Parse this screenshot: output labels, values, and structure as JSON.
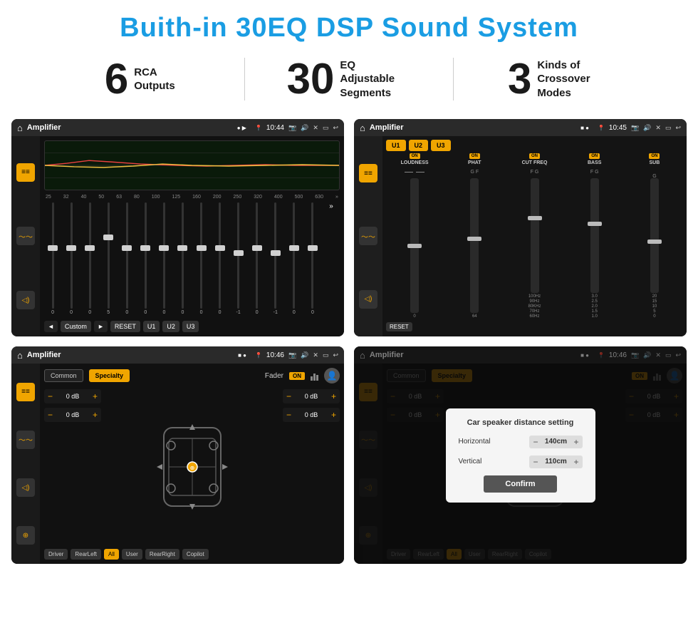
{
  "page": {
    "title": "Buith-in 30EQ DSP Sound System",
    "stats": [
      {
        "number": "6",
        "label": "RCA\nOutputs"
      },
      {
        "number": "30",
        "label": "EQ Adjustable\nSegments"
      },
      {
        "number": "3",
        "label": "Kinds of\nCrossover Modes"
      }
    ]
  },
  "screen1": {
    "title": "Amplifier",
    "time": "10:44",
    "freq_labels": [
      "25",
      "32",
      "40",
      "50",
      "63",
      "80",
      "100",
      "125",
      "160",
      "200",
      "250",
      "320",
      "400",
      "500",
      "630"
    ],
    "slider_values": [
      "0",
      "0",
      "0",
      "5",
      "0",
      "0",
      "0",
      "0",
      "0",
      "0",
      "-1",
      "0",
      "-1"
    ],
    "buttons": {
      "prev": "◄",
      "label": "Custom",
      "next": "►",
      "reset": "RESET",
      "u1": "U1",
      "u2": "U2",
      "u3": "U3"
    }
  },
  "screen2": {
    "title": "Amplifier",
    "time": "10:45",
    "presets": {
      "u1": "U1",
      "u2": "U2",
      "u3": "U3"
    },
    "channels": [
      {
        "label": "LOUDNESS",
        "on": true
      },
      {
        "label": "PHAT",
        "on": true
      },
      {
        "label": "CUT FREQ",
        "on": true
      },
      {
        "label": "BASS",
        "on": true
      },
      {
        "label": "SUB",
        "on": true
      }
    ],
    "reset_btn": "RESET"
  },
  "screen3": {
    "title": "Amplifier",
    "time": "10:46",
    "tabs": {
      "common": "Common",
      "specialty": "Specialty"
    },
    "fader_label": "Fader",
    "fader_on": "ON",
    "volumes": {
      "fl": "0 dB",
      "rl": "0 dB",
      "fr": "0 dB",
      "rr": "0 dB"
    },
    "zones": [
      "Driver",
      "RearLeft",
      "All",
      "User",
      "RearRight",
      "Copilot"
    ]
  },
  "screen4": {
    "title": "Amplifier",
    "time": "10:46",
    "tabs": {
      "common": "Common",
      "specialty": "Specialty"
    },
    "dialog": {
      "title": "Car speaker distance setting",
      "horizontal_label": "Horizontal",
      "horizontal_value": "140cm",
      "vertical_label": "Vertical",
      "vertical_value": "110cm",
      "confirm_btn": "Confirm"
    },
    "zones": [
      "Driver",
      "RearLeft",
      "All",
      "User",
      "RearRight",
      "Copilot"
    ],
    "volumes": {
      "right1": "0 dB",
      "right2": "0 dB"
    }
  }
}
